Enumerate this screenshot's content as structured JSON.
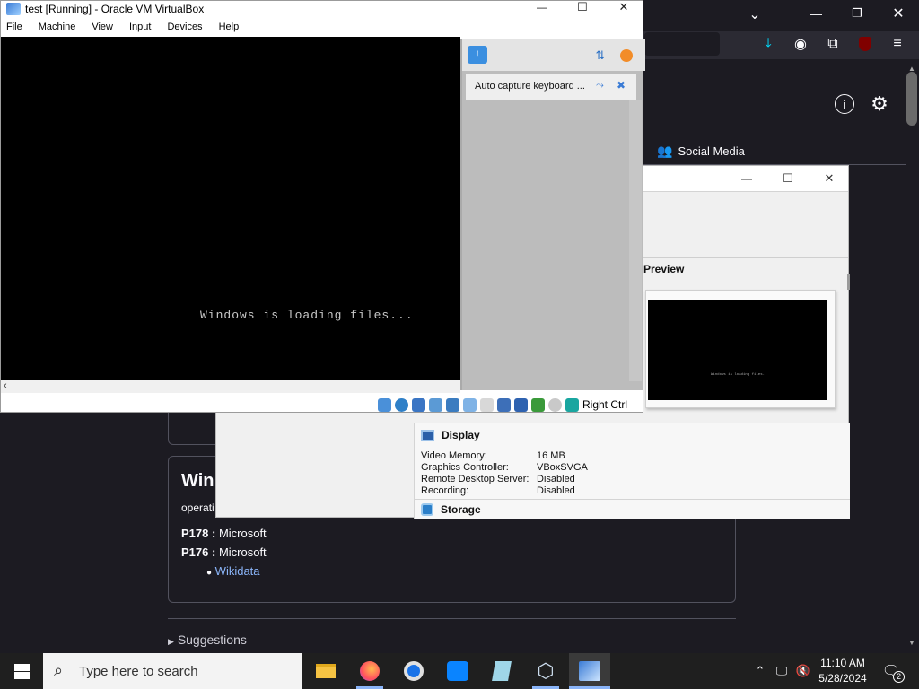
{
  "colors": {
    "browser_bg": "#1c1b22",
    "vm_screen": "#000000",
    "link": "#8ab4f8",
    "taskbar": "#1f1f1f"
  },
  "vm_window": {
    "title": "test [Running] - Oracle VM VirtualBox",
    "menu": [
      "File",
      "Machine",
      "View",
      "Input",
      "Devices",
      "Help"
    ],
    "screen_text": "Windows is loading files...",
    "notification": "Auto capture keyboard ...",
    "host_key": "Right Ctrl"
  },
  "browser": {
    "tab_social_media": "Social Media",
    "card_title": "Win",
    "card_subtitle": "operati",
    "props": [
      {
        "key": "P178 :",
        "value": "Microsoft"
      },
      {
        "key": "P176 :",
        "value": "Microsoft"
      }
    ],
    "wikidata_link": "Wikidata",
    "suggestions": "Suggestions"
  },
  "vbox_manager": {
    "preview_label": "Preview",
    "preview_text": "Windows is loading files.",
    "display_label": "Display",
    "display_rows": [
      {
        "key": "Video Memory:",
        "value": "16 MB"
      },
      {
        "key": "Graphics Controller:",
        "value": "VBoxSVGA"
      },
      {
        "key": "Remote Desktop Server:",
        "value": "Disabled"
      },
      {
        "key": "Recording:",
        "value": "Disabled"
      }
    ],
    "storage_label": "Storage"
  },
  "taskbar": {
    "search_placeholder": "Type here to search",
    "time": "11:10 AM",
    "date": "5/28/2024",
    "notification_count": "2"
  }
}
